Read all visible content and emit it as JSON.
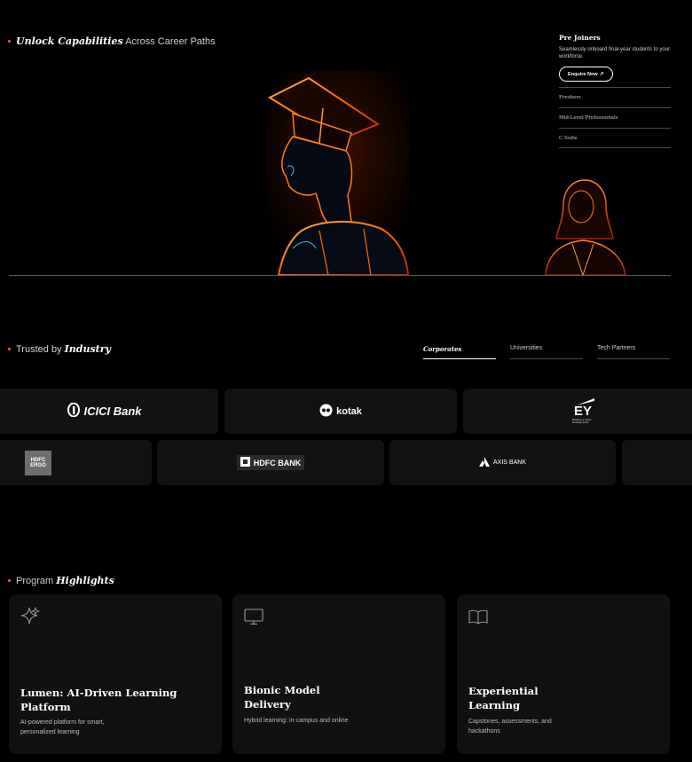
{
  "hero": {
    "heading_bold": "Unlock Capabilities",
    "heading_rest": " Across Career Paths"
  },
  "career_panel": {
    "title": "Pre Joiners",
    "description": "Seamlessly onboard final-year students to your workforce.",
    "cta_label": "Enquire Now",
    "cta_icon": "arrow-up-right-icon",
    "items": [
      {
        "label": "Freshers"
      },
      {
        "label": "Mid-Level Professionals"
      },
      {
        "label": "C-Suite"
      }
    ]
  },
  "trusted": {
    "heading_plain": "Trusted by ",
    "heading_em": "Industry",
    "tabs": [
      {
        "label": "Corporates",
        "active": true
      },
      {
        "label": "Universities",
        "active": false
      },
      {
        "label": "Tech Partners",
        "active": false
      }
    ],
    "logos_row1": [
      {
        "name": "ICICI Bank"
      },
      {
        "name": "kotak"
      },
      {
        "name": "EY",
        "tagline": "Building a better working world"
      }
    ],
    "logos_row2": [
      {
        "name": "HDFC ERGO"
      },
      {
        "name": "HDFC BANK"
      },
      {
        "name": "AXIS BANK"
      }
    ]
  },
  "highlights": {
    "heading_plain": "Program ",
    "heading_em": "Highlights",
    "cards": [
      {
        "icon": "sparkle-icon",
        "title": "Lumen: AI-Driven Learning Platform",
        "desc": "AI-powered platform for smart, personalized learning"
      },
      {
        "icon": "monitor-icon",
        "title": "Bionic Model Delivery",
        "desc": "Hybrid learning: in-campus and online"
      },
      {
        "icon": "book-icon",
        "title": "Experiential Learning",
        "desc": "Capstones, assessments, and hackathons"
      }
    ]
  },
  "colors": {
    "accent": "#f26522",
    "background": "#000000",
    "card": "#111111"
  }
}
